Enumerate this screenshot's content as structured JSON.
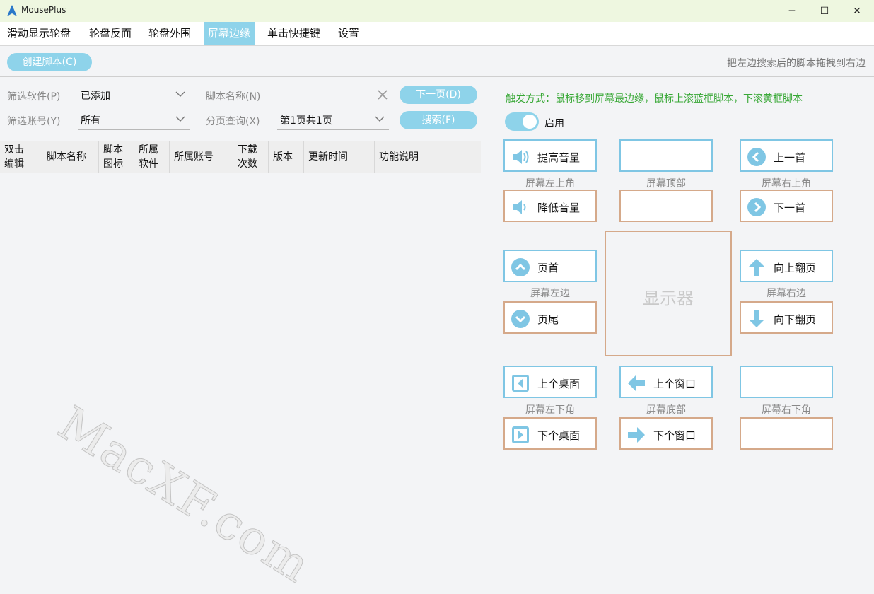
{
  "window": {
    "title": "MousePlus",
    "minimize": "─",
    "maximize": "☐",
    "close": "✕"
  },
  "menu": {
    "items": [
      "滑动显示轮盘",
      "轮盘反面",
      "轮盘外围",
      "屏幕边缘",
      "单击快捷键",
      "设置"
    ],
    "active": "屏幕边缘"
  },
  "toolbar": {
    "create_label": "创建脚本(C)",
    "hint": "把左边搜索后的脚本拖拽到右边"
  },
  "filters": {
    "software_label": "筛选软件(P)",
    "software_value": "已添加",
    "account_label": "筛选账号(Y)",
    "account_value": "所有",
    "name_label": "脚本名称(N)",
    "name_value": "",
    "page_label": "分页查询(X)",
    "page_value": "第1页共1页",
    "next_label": "下一页(D)",
    "search_label": "搜索(F)"
  },
  "table": {
    "headers": [
      "双击\n编辑",
      "脚本名称",
      "脚本\n图标",
      "所属\n软件",
      "所属账号",
      "下载\n次数",
      "版本",
      "更新时间",
      "功能说明"
    ]
  },
  "right_panel": {
    "trigger_text": "触发方式：鼠标移到屏幕最边缘，鼠标上滚蓝框脚本，下滚黄框脚本",
    "toggle_label": "启用",
    "toggle_on": true,
    "monitor_label": "显示器",
    "zones": {
      "top_left": "屏幕左上角",
      "top": "屏幕顶部",
      "top_right": "屏幕右上角",
      "left": "屏幕左边",
      "right": "屏幕右边",
      "bottom_left": "屏幕左下角",
      "bottom": "屏幕底部",
      "bottom_right": "屏幕右下角"
    },
    "slots": {
      "top_left_up": {
        "label": "提高音量",
        "icon": "volume-up-icon"
      },
      "top_left_down": {
        "label": "降低音量",
        "icon": "volume-down-icon"
      },
      "top_right_up": {
        "label": "上一首",
        "icon": "previous-icon"
      },
      "top_right_down": {
        "label": "下一首",
        "icon": "next-icon"
      },
      "left_up": {
        "label": "页首",
        "icon": "chevron-up-icon"
      },
      "left_down": {
        "label": "页尾",
        "icon": "chevron-down-icon"
      },
      "right_up": {
        "label": "向上翻页",
        "icon": "arrow-up-icon"
      },
      "right_down": {
        "label": "向下翻页",
        "icon": "arrow-down-icon"
      },
      "bottom_left_up": {
        "label": "上个桌面",
        "icon": "desktop-prev-icon"
      },
      "bottom_left_down": {
        "label": "下个桌面",
        "icon": "desktop-next-icon"
      },
      "bottom_up": {
        "label": "上个窗口",
        "icon": "arrow-left-icon"
      },
      "bottom_down": {
        "label": "下个窗口",
        "icon": "arrow-right-icon"
      }
    }
  },
  "watermark": "MacXF.com",
  "colors": {
    "accent": "#8ed3ea",
    "blue_border": "#7fc6e4",
    "tan_border": "#d5a98a",
    "trigger_green": "#38a836"
  }
}
